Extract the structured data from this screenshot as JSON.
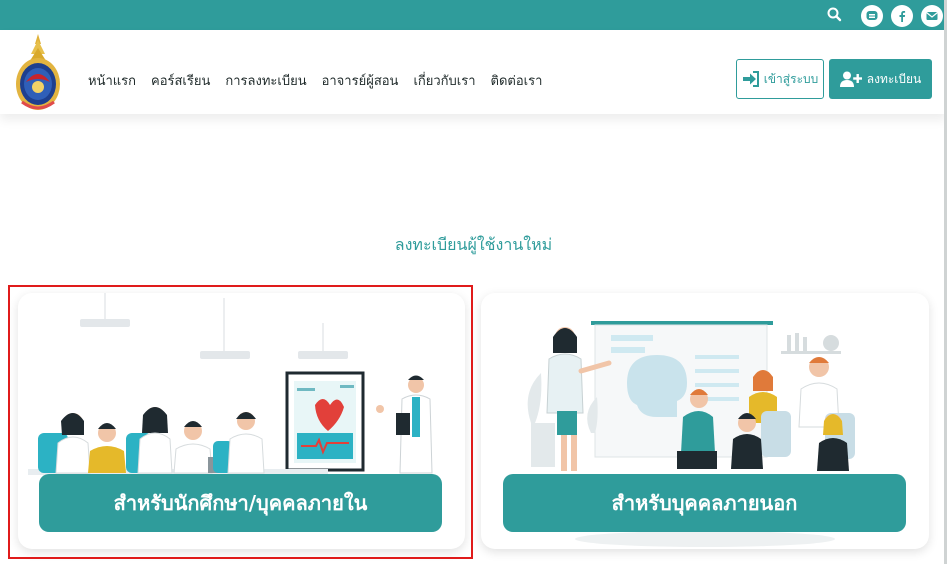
{
  "topbar": {
    "icons": [
      "search-icon",
      "line-icon",
      "facebook-icon",
      "email-icon"
    ],
    "color": "#2f9c9b"
  },
  "nav": {
    "items": [
      {
        "label": "หน้าแรก"
      },
      {
        "label": "คอร์สเรียน"
      },
      {
        "label": "การลงทะเบียน"
      },
      {
        "label": "อาจารย์ผู้สอน"
      },
      {
        "label": "เกี่ยวกับเรา"
      },
      {
        "label": "ติดต่อเรา"
      }
    ]
  },
  "header": {
    "login_label": "เข้าสู่ระบบ",
    "register_label": "ลงทะเบียน"
  },
  "main": {
    "title": "ลงทะเบียนผู้ใช้งานใหม่",
    "cards": [
      {
        "label": "สำหรับนักศึกษา/บุคคลภายใน",
        "image": "students-classroom-illustration"
      },
      {
        "label": "สำหรับบุคคลภายนอก",
        "image": "doctor-presentation-illustration"
      }
    ]
  }
}
